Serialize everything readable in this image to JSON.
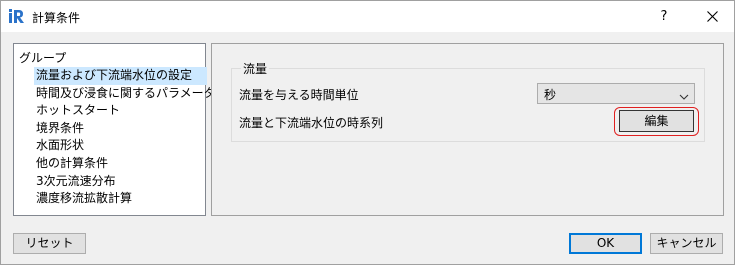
{
  "window": {
    "title": "計算条件",
    "help_label": "?",
    "close_icon": "close-icon",
    "app_icon": "iric-logo-icon"
  },
  "groups": {
    "title": "グループ",
    "items": [
      {
        "label": "流量および下流端水位の設定",
        "selected": true
      },
      {
        "label": "時間及び浸食に関するパラメータ",
        "selected": false
      },
      {
        "label": "ホットスタート",
        "selected": false
      },
      {
        "label": "境界条件",
        "selected": false
      },
      {
        "label": "水面形状",
        "selected": false
      },
      {
        "label": "他の計算条件",
        "selected": false
      },
      {
        "label": "3次元流速分布",
        "selected": false
      },
      {
        "label": "濃度移流拡散計算",
        "selected": false
      }
    ]
  },
  "flow": {
    "group_label": "流量",
    "time_unit_label": "流量を与える時間単位",
    "time_unit_value": "秒",
    "series_label": "流量と下流端水位の時系列",
    "edit_label": "編集",
    "highlight_color": "#e02020"
  },
  "footer": {
    "reset_label": "リセット",
    "ok_label": "OK",
    "cancel_label": "キャンセル"
  },
  "colors": {
    "selection": "#cce8ff",
    "default_button_border": "#0078d7"
  }
}
